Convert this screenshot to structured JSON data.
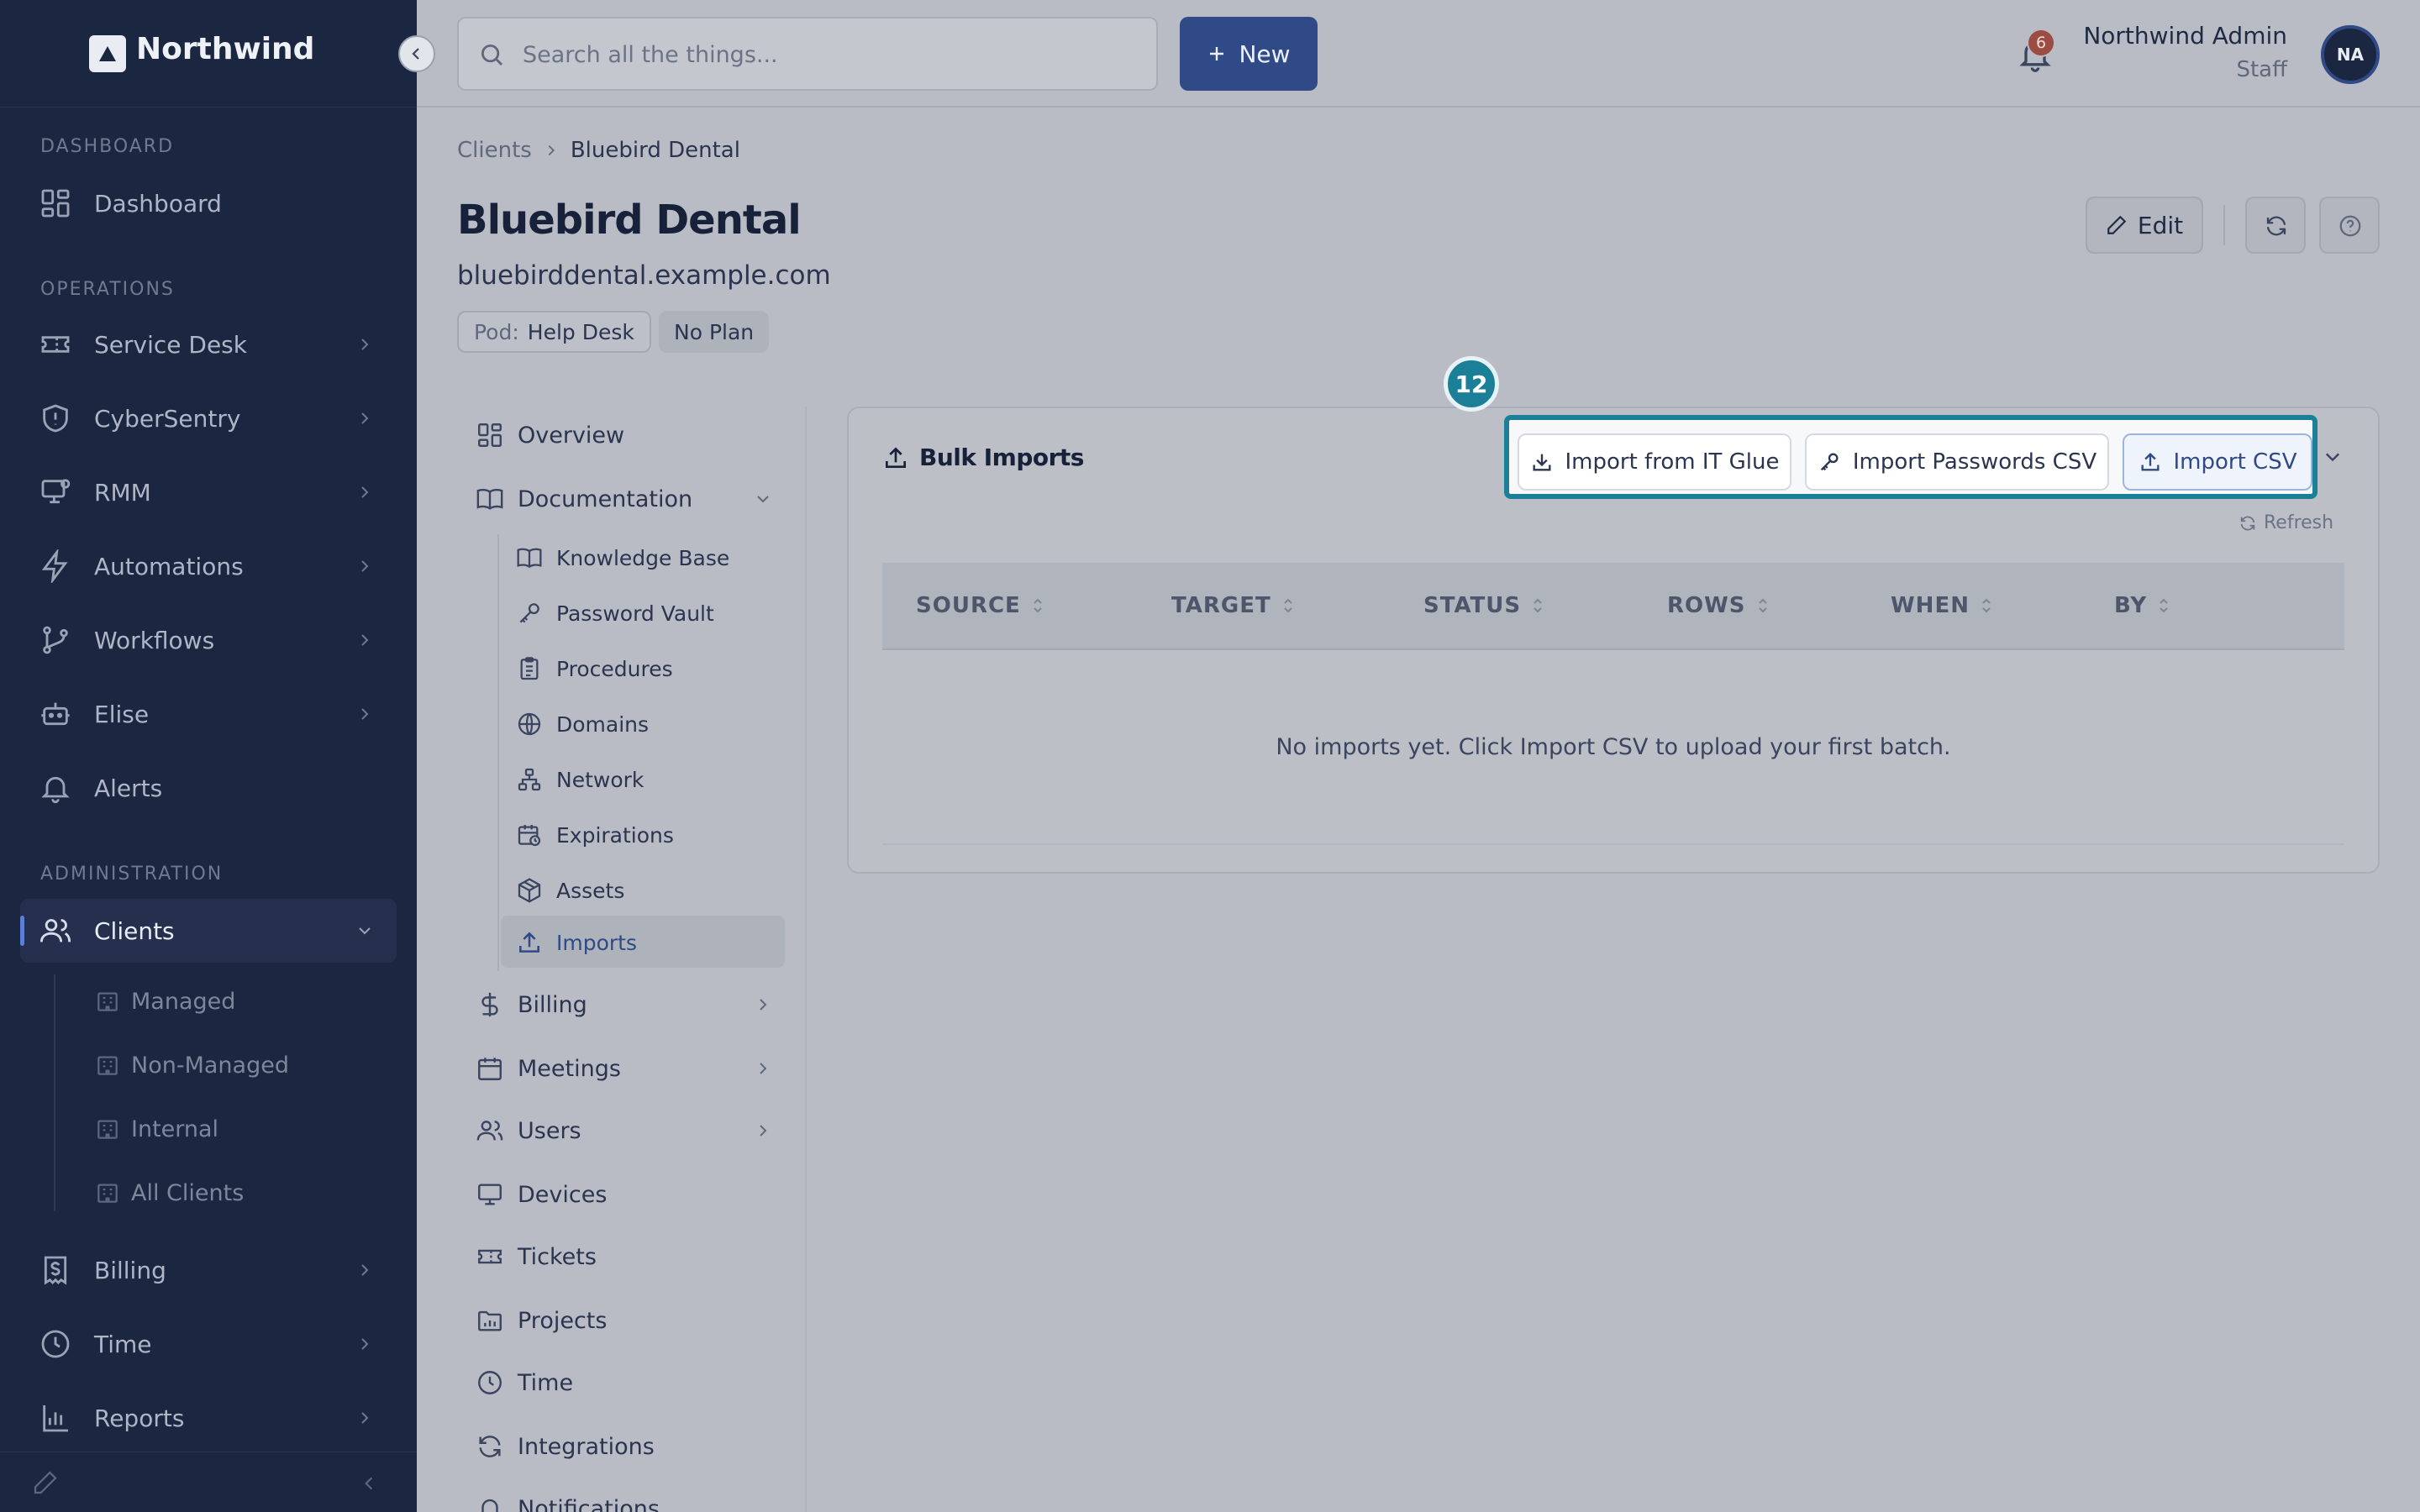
{
  "brand": {
    "name": "Northwind"
  },
  "sidebar": {
    "sections": {
      "dashboard": "DASHBOARD",
      "operations": "OPERATIONS",
      "administration": "ADMINISTRATION"
    },
    "items": {
      "dashboard": "Dashboard",
      "service_desk": "Service Desk",
      "cybersentry": "CyberSentry",
      "rmm": "RMM",
      "automations": "Automations",
      "workflows": "Workflows",
      "elise": "Elise",
      "alerts": "Alerts",
      "clients": "Clients",
      "billing": "Billing",
      "time": "Time",
      "reports": "Reports"
    },
    "client_sub": [
      "Managed",
      "Non-Managed",
      "Internal",
      "All Clients"
    ]
  },
  "topbar": {
    "search_placeholder": "Search all the things...",
    "new_label": "New",
    "notification_count": "6",
    "user_name": "Northwind Admin",
    "user_role": "Staff",
    "avatar_initials": "NA"
  },
  "breadcrumb": [
    "Clients",
    "Bluebird Dental"
  ],
  "client": {
    "name": "Bluebird Dental",
    "domain": "bluebirddental.example.com",
    "pod_key": "Pod:",
    "pod_value": "Help Desk",
    "plan": "No Plan"
  },
  "header_actions": {
    "edit_label": "Edit"
  },
  "subnav": {
    "overview": "Overview",
    "documentation": "Documentation",
    "doc_items": [
      "Knowledge Base",
      "Password Vault",
      "Procedures",
      "Domains",
      "Network",
      "Expirations",
      "Assets",
      "Imports"
    ],
    "billing": "Billing",
    "meetings": "Meetings",
    "users": "Users",
    "devices": "Devices",
    "tickets": "Tickets",
    "projects": "Projects",
    "time": "Time",
    "integrations": "Integrations",
    "notifications": "Notifications"
  },
  "imports_card": {
    "title": "Bulk Imports",
    "marker": "12",
    "btn_itglue": "Import from IT Glue",
    "btn_passwords": "Import Passwords CSV",
    "btn_csv": "Import CSV",
    "refresh": "Refresh",
    "columns": [
      "SOURCE",
      "TARGET",
      "STATUS",
      "ROWS",
      "WHEN",
      "BY"
    ],
    "empty_message": "No imports yet. Click Import CSV to upload your first batch."
  },
  "colors": {
    "sidebar_bg": "#1b2641",
    "primary": "#2f4a86",
    "highlight": "#1a7f97",
    "badge": "#9b4d43"
  }
}
